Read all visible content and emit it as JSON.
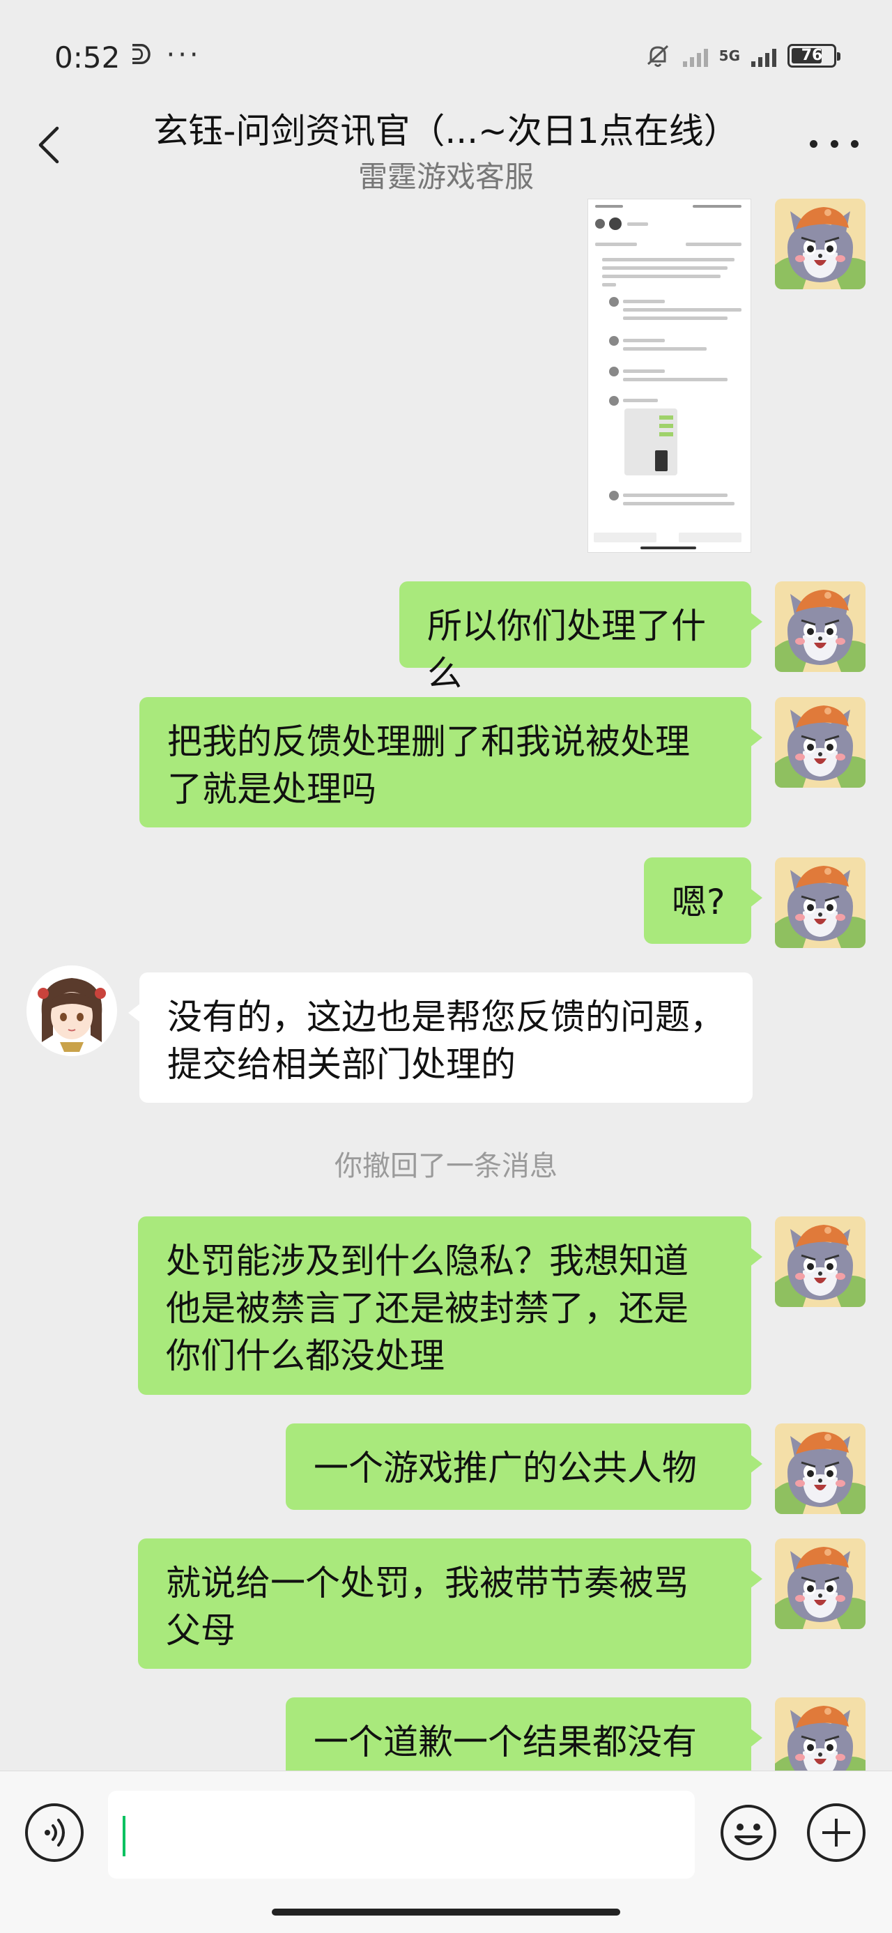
{
  "status_bar": {
    "time": "0:52",
    "left_icons": "ᕲ ···",
    "network": "5G",
    "battery": "76",
    "battery_level_percent": 76
  },
  "header": {
    "title": "玄钰-问剑资讯官（...~次日1点在线）",
    "subtitle": "雷霆游戏客服",
    "back_icon": "chevron-left-icon",
    "more_icon": "more-dots-icon"
  },
  "messages": [
    {
      "type": "image",
      "from": "me"
    },
    {
      "type": "text",
      "from": "me",
      "text": "所以你们处理了什么"
    },
    {
      "type": "text",
      "from": "me",
      "lines": [
        "把我的反馈处理删了和我说被处理",
        "了就是处理吗"
      ]
    },
    {
      "type": "text",
      "from": "me",
      "text": "嗯?"
    },
    {
      "type": "text",
      "from": "other",
      "lines": [
        "没有的，这边也是帮您反馈的问题，",
        "提交给相关部门处理的"
      ]
    },
    {
      "type": "system",
      "text": "你撤回了一条消息"
    },
    {
      "type": "text",
      "from": "me",
      "lines": [
        "处罚能涉及到什么隐私？我想知道",
        "他是被禁言了还是被封禁了，还是",
        "你们什么都没处理"
      ]
    },
    {
      "type": "text",
      "from": "me",
      "text": "一个游戏推广的公共人物"
    },
    {
      "type": "text",
      "from": "me",
      "lines": [
        "就说给一个处罚，我被带节奏被骂",
        "父母"
      ]
    },
    {
      "type": "text",
      "from": "me",
      "text": "一个道歉一个结果都没有"
    }
  ],
  "input_bar": {
    "voice_icon": "voice-icon",
    "emoji_icon": "emoji-icon",
    "plus_icon": "plus-icon",
    "input_value": ""
  },
  "colors": {
    "my_bubble": "#a9e97c",
    "other_bubble": "#ffffff",
    "background": "#ededed",
    "caret": "#07c160"
  }
}
